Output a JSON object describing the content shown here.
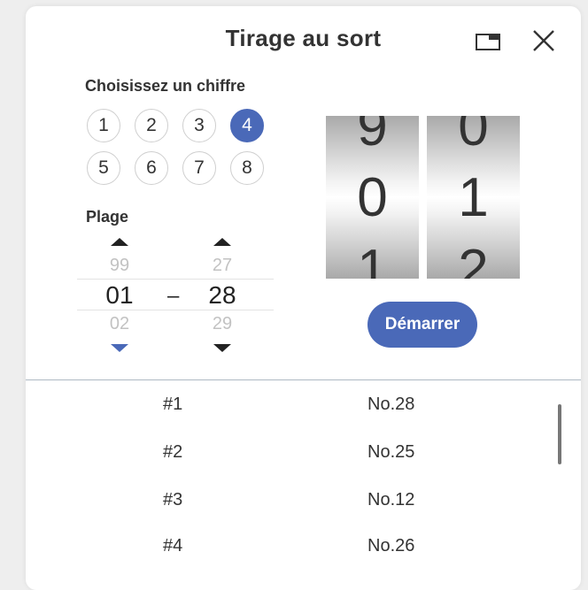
{
  "header": {
    "title": "Tirage au sort",
    "window_icon": "window-mode-icon",
    "close_icon": "close-icon"
  },
  "digit_picker": {
    "label": "Choisissez un chiffre",
    "options": [
      "1",
      "2",
      "3",
      "4",
      "5",
      "6",
      "7",
      "8"
    ],
    "selected": "4"
  },
  "range": {
    "label": "Plage",
    "from": {
      "prev": "99",
      "current": "01",
      "next": "02"
    },
    "separator": "–",
    "to": {
      "prev": "27",
      "current": "28",
      "next": "29"
    }
  },
  "drums": [
    {
      "above": "9",
      "current": "0",
      "below": "1"
    },
    {
      "above": "0",
      "current": "1",
      "below": "2"
    }
  ],
  "start_button": "Démarrer",
  "results": [
    {
      "index": "#1",
      "value": "No.28"
    },
    {
      "index": "#2",
      "value": "No.25"
    },
    {
      "index": "#3",
      "value": "No.12"
    },
    {
      "index": "#4",
      "value": "No.26"
    }
  ],
  "colors": {
    "accent": "#4a69b8",
    "background": "#eeeeee",
    "panel": "#ffffff"
  }
}
